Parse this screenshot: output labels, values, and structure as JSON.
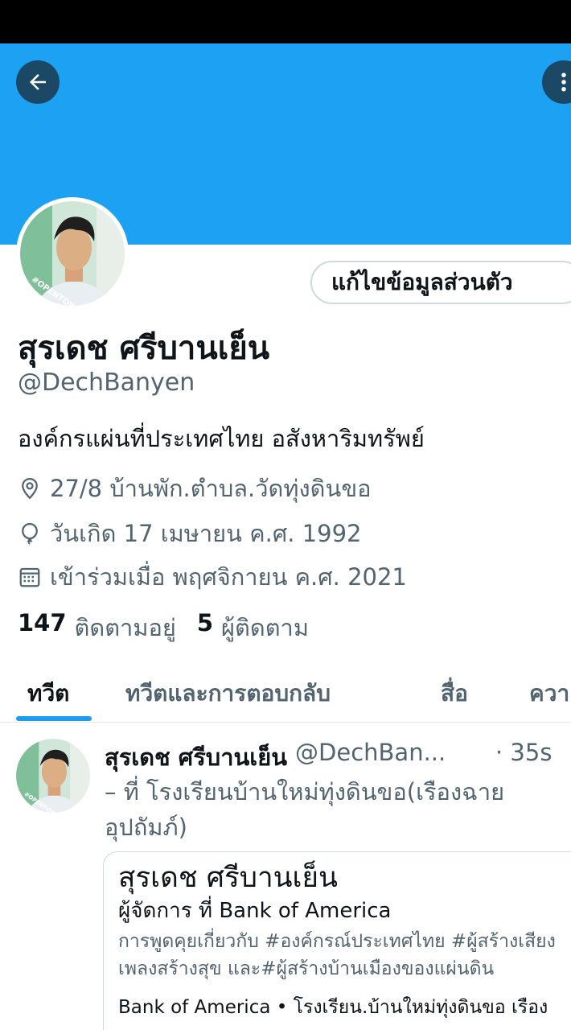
{
  "profile": {
    "name": "สุรเดช ศรีบานเย็น",
    "handle": "@DechBanyen",
    "bio": "องค์กรแผ่นที่ประเทศไทย อสังหาริมทรัพย์",
    "location": "27/8 บ้านพัก.ตำบล.วัดทุ่งดินขอ",
    "birthday": "วันเกิด 17 เมษายน ค.ศ. 1992",
    "joined": "เข้าร่วมเมื่อ พฤศจิกายน ค.ศ. 2021",
    "edit_button": "แก้ไขข้อมูลส่วนตัว",
    "avatar_badge": "#OPENTOWORK"
  },
  "stats": {
    "following_count": "147",
    "following_label": "ติดตามอยู่",
    "followers_count": "5",
    "followers_label": "ผู้ติดตาม"
  },
  "tabs": [
    {
      "label": "ทวีต",
      "active": true
    },
    {
      "label": "ทวีตและการตอบกลับ",
      "active": false
    },
    {
      "label": "สื่อ",
      "active": false
    },
    {
      "label": "ควา",
      "active": false
    }
  ],
  "tweet": {
    "name": "สุรเดช ศรีบานเย็น",
    "handle": "@DechBan...",
    "time": "· 35s",
    "text": "– ที่ โรงเรียนบ้านใหม่ทุ่งดินขอ(เรืองฉาย อุปถัมภ์)",
    "card": {
      "title": "สุรเดช ศรีบานเย็น",
      "subtitle": "ผู้จัดการ ที่ Bank of America",
      "description": "การพูดคุยเกี่ยวกับ #องค์กรณ์ประเทศไทย #ผู้สร้างเสียงเพลงสร้างสุข และ#ผู้สร้างบ้านเมืองของแผ่นดิน",
      "footer": "Bank of America • โรงเรียน.บ้านใหม่ทุ่งดินขอ เรือง"
    }
  },
  "colors": {
    "banner": "#1da1f2",
    "accent": "#1d9bf0",
    "badge_green": "#2e9e4f"
  },
  "icons": [
    "back-arrow-icon",
    "more-vertical-icon",
    "location-pin-icon",
    "birthday-balloon-icon",
    "calendar-icon"
  ]
}
